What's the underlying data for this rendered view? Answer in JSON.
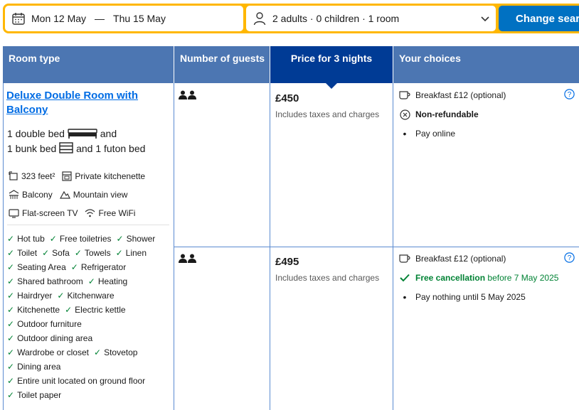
{
  "search": {
    "dates_from": "Mon 12 May",
    "dates_sep": "—",
    "dates_to": "Thu 15 May",
    "guests": "2 adults · 0 children · 1 room",
    "button": "Change search"
  },
  "table_headers": {
    "room_type": "Room type",
    "guests": "Number of guests",
    "price": "Price for 3 nights",
    "choices": "Your choices"
  },
  "room": {
    "title_line1": "Deluxe Double Room with",
    "title_line2": "Balcony",
    "beds_line1_a": "1 double bed",
    "beds_line1_b": "and",
    "beds_line2_a": "1 bunk bed",
    "beds_line2_b": "and 1 futon bed",
    "facilities": [
      {
        "icon": "area-icon",
        "label": "323 feet²"
      },
      {
        "icon": "kitchenette-icon",
        "label": "Private kitchenette"
      },
      {
        "icon": "balcony-icon",
        "label": "Balcony"
      },
      {
        "icon": "mountain-icon",
        "label": "Mountain view"
      },
      {
        "icon": "tv-icon",
        "label": "Flat-screen TV"
      },
      {
        "icon": "wifi-icon",
        "label": "Free WiFi"
      }
    ],
    "amenities": [
      "Hot tub",
      "Free toiletries",
      "Shower",
      "Toilet",
      "Sofa",
      "Towels",
      "Linen",
      "Seating Area",
      "Refrigerator",
      "Shared bathroom",
      "Heating",
      "Hairdryer",
      "Kitchenware",
      "Kitchenette",
      "Electric kettle",
      "Outdoor furniture",
      "Outdoor dining area",
      "Wardrobe or closet",
      "Stovetop",
      "Dining area",
      "Entire unit located on ground floor",
      "Toilet paper"
    ]
  },
  "options": [
    {
      "price": "£450",
      "taxes": "Includes taxes and charges",
      "breakfast": "Breakfast £12 (optional)",
      "policy": "Non-refundable",
      "payment": "Pay online"
    },
    {
      "price": "£495",
      "taxes": "Includes taxes and charges",
      "breakfast": "Breakfast £12 (optional)",
      "policy": "Free cancellation",
      "policy_suffix": "before 7 May 2025",
      "payment": "Pay nothing until 5 May 2025"
    }
  ],
  "colors": {
    "header": "#4c76b2",
    "header_selected": "#003b95",
    "accent": "#ffb700",
    "link": "#006ce4",
    "green": "#008234"
  }
}
